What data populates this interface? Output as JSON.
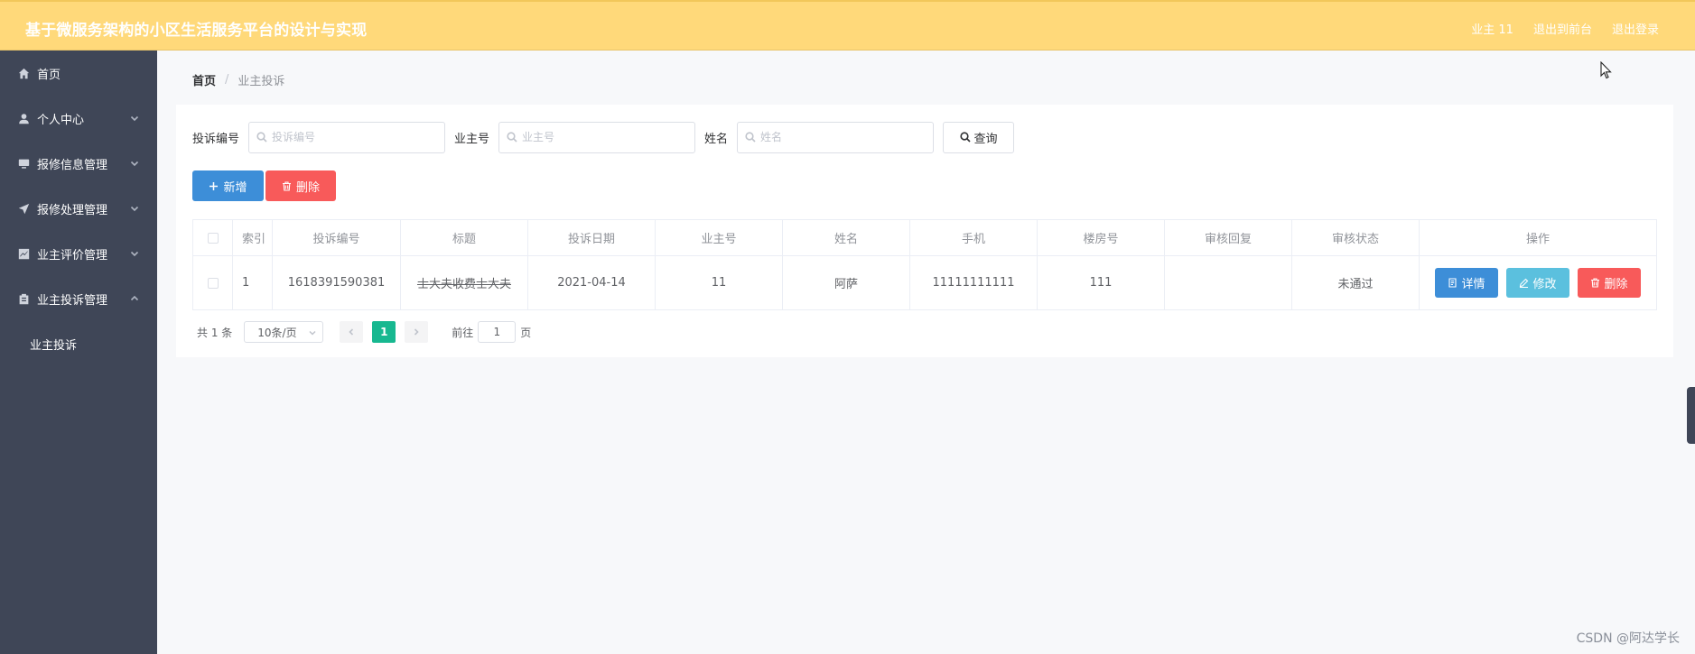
{
  "header": {
    "title": "基于微服务架构的小区生活服务平台的设计与实现",
    "user": "业主 11",
    "back_front": "退出到前台",
    "logout": "退出登录"
  },
  "sidebar": {
    "items": [
      {
        "label": "首页",
        "icon": "home-icon"
      },
      {
        "label": "个人中心",
        "icon": "user-icon",
        "expanded": false
      },
      {
        "label": "报修信息管理",
        "icon": "monitor-icon",
        "expanded": false
      },
      {
        "label": "报修处理管理",
        "icon": "send-icon",
        "expanded": false
      },
      {
        "label": "业主评价管理",
        "icon": "chart-icon",
        "expanded": false
      },
      {
        "label": "业主投诉管理",
        "icon": "clipboard-icon",
        "expanded": true
      }
    ],
    "sub_items": [
      {
        "label": "业主投诉"
      }
    ]
  },
  "breadcrumb": {
    "home": "首页",
    "separator": "/",
    "current": "业主投诉"
  },
  "search": {
    "complaint_no_label": "投诉编号",
    "complaint_no_placeholder": "投诉编号",
    "owner_no_label": "业主号",
    "owner_no_placeholder": "业主号",
    "name_label": "姓名",
    "name_placeholder": "姓名",
    "query_button": "查询"
  },
  "actions": {
    "add": "新增",
    "delete": "删除"
  },
  "table": {
    "headers": [
      "索引",
      "投诉编号",
      "标题",
      "投诉日期",
      "业主号",
      "姓名",
      "手机",
      "楼房号",
      "审核回复",
      "审核状态",
      "操作"
    ],
    "rows": [
      {
        "index": "1",
        "complaint_no": "1618391590381",
        "title": "士大夫收费士大夫",
        "date": "2021-04-14",
        "owner_no": "11",
        "name": "阿萨",
        "phone": "11111111111",
        "room": "111",
        "reply": "",
        "status": "未通过"
      }
    ],
    "row_actions": {
      "detail": "详情",
      "edit": "修改",
      "delete": "删除"
    }
  },
  "pagination": {
    "total": "共 1 条",
    "page_size": "10条/页",
    "current_page": "1",
    "goto_prefix": "前往",
    "goto_value": "1",
    "goto_suffix": "页"
  },
  "watermark": "CSDN @阿达学长",
  "colors": {
    "topbar": "#ffd97a",
    "sidebar": "#3f4657",
    "primary": "#3d8ed8",
    "danger": "#f85a5a",
    "info": "#5bc0de",
    "page_active": "#17b890"
  }
}
